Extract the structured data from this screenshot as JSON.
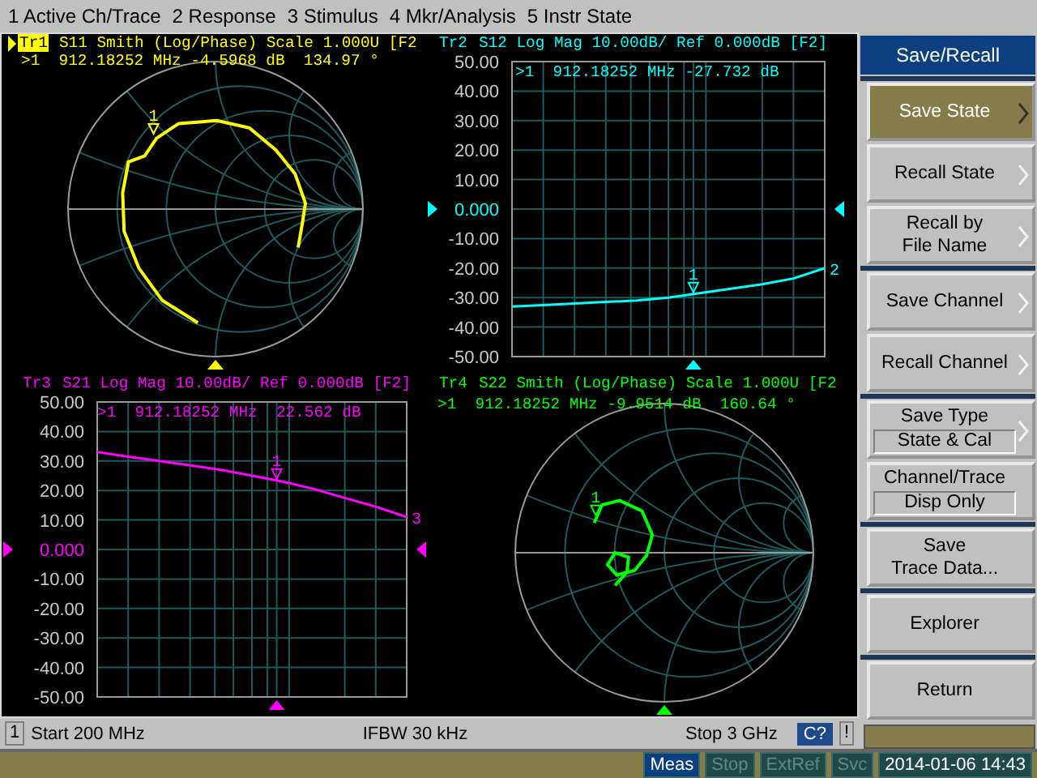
{
  "menu": [
    "1 Active Ch/Trace",
    "2 Response",
    "3 Stimulus",
    "4 Mkr/Analysis",
    "5 Instr State"
  ],
  "traces": [
    {
      "kind": "smith",
      "id": "Tr1",
      "active": true,
      "color": "#ffff00",
      "title": "S11 Smith (Log/Phase) Scale 1.000U [F2",
      "readout": ">1  912.18252 MHz -4.5968 dB  134.97 °",
      "marker_label": "1"
    },
    {
      "kind": "logmag",
      "id": "Tr2",
      "active": false,
      "color": "#00ffff",
      "title": "S12 Log Mag 10.00dB/ Ref 0.000dB [F2]",
      "readout": ">1  912.18252 MHz -27.732 dB",
      "marker_label": "1",
      "end_label": "2",
      "chart_data": {
        "type": "line",
        "ylim": [
          -50,
          50
        ],
        "yticks": [
          {
            "value": 50,
            "label": "50.00"
          },
          {
            "value": 40,
            "label": "40.00"
          },
          {
            "value": 30,
            "label": "30.00"
          },
          {
            "value": 20,
            "label": "20.00"
          },
          {
            "value": 10,
            "label": "10.00"
          },
          {
            "value": 0,
            "label": "0.000"
          },
          {
            "value": -10,
            "label": "-10.00"
          },
          {
            "value": -20,
            "label": "-20.00"
          },
          {
            "value": -30,
            "label": "-30.00"
          },
          {
            "value": -40,
            "label": "-40.00"
          },
          {
            "value": -50,
            "label": "-50.00"
          }
        ],
        "grid": true,
        "series": [
          {
            "color": "#00ffff",
            "values": [
              -33,
              -32.5,
              -32,
              -31.5,
              -31,
              -30,
              -28.5,
              -27,
              -25.5,
              -23.5,
              -20
            ]
          }
        ]
      }
    },
    {
      "kind": "logmag",
      "id": "Tr3",
      "active": false,
      "color": "#ff00ff",
      "title": "S21 Log Mag 10.00dB/ Ref 0.000dB [F2]",
      "readout": ">1  912.18252 MHz  22.562 dB",
      "marker_label": "1",
      "end_label": "3",
      "chart_data": {
        "type": "line",
        "ylim": [
          -50,
          50
        ],
        "yticks": [
          {
            "value": 50,
            "label": "50.00"
          },
          {
            "value": 40,
            "label": "40.00"
          },
          {
            "value": 30,
            "label": "30.00"
          },
          {
            "value": 20,
            "label": "20.00"
          },
          {
            "value": 10,
            "label": "10.00"
          },
          {
            "value": 0,
            "label": "0.000"
          },
          {
            "value": -10,
            "label": "-10.00"
          },
          {
            "value": -20,
            "label": "-20.00"
          },
          {
            "value": -30,
            "label": "-30.00"
          },
          {
            "value": -40,
            "label": "-40.00"
          },
          {
            "value": -50,
            "label": "-50.00"
          }
        ],
        "grid": true,
        "series": [
          {
            "color": "#ff00ff",
            "values": [
              33,
              31.5,
              30,
              28.5,
              27,
              25,
              23,
              20.5,
              17.5,
              14.5,
              11
            ]
          }
        ]
      }
    },
    {
      "kind": "smith",
      "id": "Tr4",
      "active": false,
      "color": "#00ff00",
      "title": "S22 Smith (Log/Phase) Scale 1.000U [F2",
      "readout": ">1  912.18252 MHz -9.9514 dB  160.64 °",
      "marker_label": "1"
    }
  ],
  "status_bar": {
    "channel": "1",
    "start": "Start 200 MHz",
    "ifbw": "IFBW 30 kHz",
    "stop": "Stop 3 GHz",
    "cal": "C?",
    "alert": "!"
  },
  "softkeys": {
    "title": "Save/Recall",
    "groups": [
      [
        {
          "label": "Save State",
          "selected": true,
          "submenu": true
        },
        {
          "label": "Recall State",
          "selected": false,
          "submenu": true
        },
        {
          "label": "Recall by\nFile Name",
          "selected": false,
          "submenu": true
        }
      ],
      [
        {
          "label": "Save Channel",
          "selected": false,
          "submenu": true
        },
        {
          "label": "Recall Channel",
          "selected": false,
          "submenu": true
        }
      ],
      [
        {
          "label": "Save Type",
          "selected": false,
          "submenu": true,
          "value": "State & Cal"
        },
        {
          "label": "Channel/Trace",
          "selected": false,
          "submenu": false,
          "value": "Disp Only"
        }
      ],
      [
        {
          "label": "Save\nTrace Data...",
          "selected": false,
          "submenu": false
        }
      ],
      [
        {
          "label": "Explorer",
          "selected": false,
          "submenu": false
        }
      ],
      [
        {
          "label": "Return",
          "selected": false,
          "submenu": false
        }
      ]
    ]
  },
  "indicators": [
    {
      "label": "Meas",
      "on": true
    },
    {
      "label": "Stop",
      "on": false
    },
    {
      "label": "ExtRef",
      "on": false
    },
    {
      "label": "Svc",
      "on": false
    }
  ],
  "datetime": "2014-01-06 14:43"
}
